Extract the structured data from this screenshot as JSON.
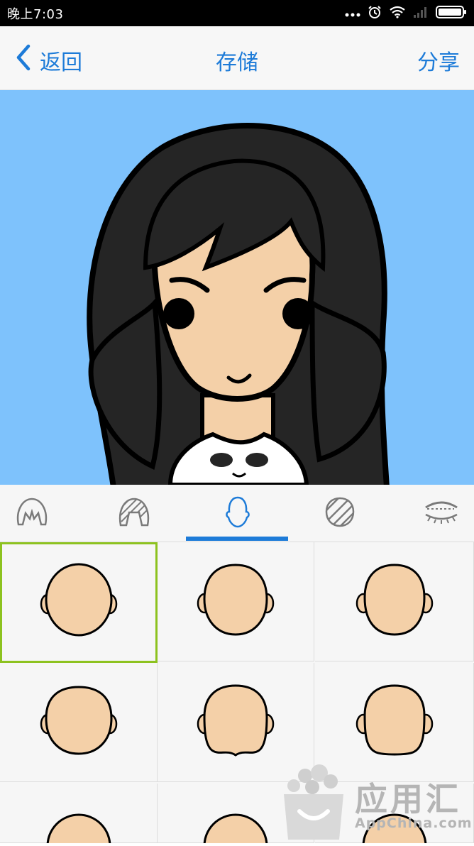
{
  "status_bar": {
    "time": "晚上7:03"
  },
  "nav": {
    "back_label": "返回",
    "title": "存储",
    "share_label": "分享"
  },
  "tabs": [
    {
      "icon": "hairstyle-icon"
    },
    {
      "icon": "bangs-icon"
    },
    {
      "icon": "face-shape-icon",
      "selected": true
    },
    {
      "icon": "hair-pattern-icon"
    },
    {
      "icon": "eyebrow-eye-icon"
    }
  ],
  "face_options": [
    {
      "icon": "round-face-icon",
      "selected": true
    },
    {
      "icon": "round-face-icon"
    },
    {
      "icon": "round-face-icon"
    },
    {
      "icon": "wide-face-icon"
    },
    {
      "icon": "square-face-icon"
    },
    {
      "icon": "square-face-icon"
    },
    {
      "icon": "round-face-icon"
    },
    {
      "icon": "round-face-icon"
    },
    {
      "icon": "round-face-icon"
    }
  ],
  "watermark": {
    "text": "应用汇",
    "url": "AppChina.com"
  },
  "colors": {
    "accent": "#1d7bd8",
    "canvas_bg": "#7ec2fc",
    "selected_border": "#8dc21f",
    "skin": "#f4d0a8",
    "hair": "#252525"
  }
}
